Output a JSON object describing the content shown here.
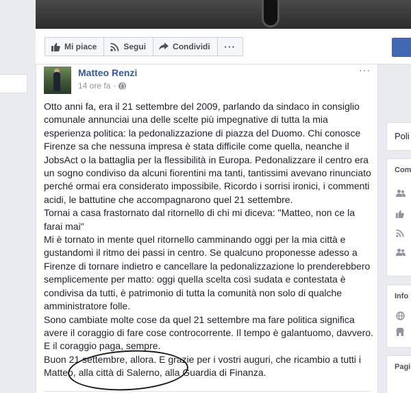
{
  "action_bar": {
    "like_label": "Mi piace",
    "follow_label": "Segui",
    "share_label": "Condividi",
    "more_label": "···"
  },
  "post": {
    "author": "Matteo Renzi",
    "time": "14 ore fa",
    "separator": "·",
    "menu_label": "···",
    "text": "Otto anni fa, era il 21 settembre del 2009, parlando da sindaco in consiglio comunale annunciai una delle scelte più impegnative di tutta la mia esperienza politica: la pedonalizzazione di piazza del Duomo. Chi conosce Firenze sa che nessuna impresa è stata difficile come quella, neanche il JobsAct o la battaglia per la flessibilità in Europa. Pedonalizzare il centro era un sogno condiviso da alcuni fiorentini ma tanti, tantissimi avevano rinunciato perché ormai era considerato impossibile. Ricordo i sorrisi ironici, i commenti acidi, le battutine che accompagnarono quel 21 settembre.\nTornai a casa frastornato dal ritornello di chi mi diceva: \"Matteo, non ce la farai mai\"\nMi è tornato in mente quel ritornello camminando oggi per la mia città e gustandomi il ritmo dei passi in centro. Se qualcuno proponesse adesso a Firenze di tornare indietro e cancellare la pedonalizzazione lo prenderebbero semplicemente per matto: oggi quella scelta così sudata e contestata è condivisa da tutti, è patrimonio di tutta la comunità non solo di qualche amministratore folle.\nSono cambiate molte cose da quel 21 settembre ma fare politica significa avere il coraggio di fare cose controcorrente. Il tempo è galantuomo, davvero. E il coraggio paga, sempre.\nBuon 21 settembre, allora. E grazie per i vostri auguri, che ricambio a tutti i Matteo, alla città di Salerno, alla Guardia di Finanza."
  },
  "sidebar": {
    "card1_title": "Poli",
    "card2_head": "Com",
    "card3_head": "Info",
    "card4_head": "Pagi"
  },
  "colors": {
    "link_blue": "#365899",
    "fb_blue": "#4267b2",
    "background": "#e9ebee"
  }
}
